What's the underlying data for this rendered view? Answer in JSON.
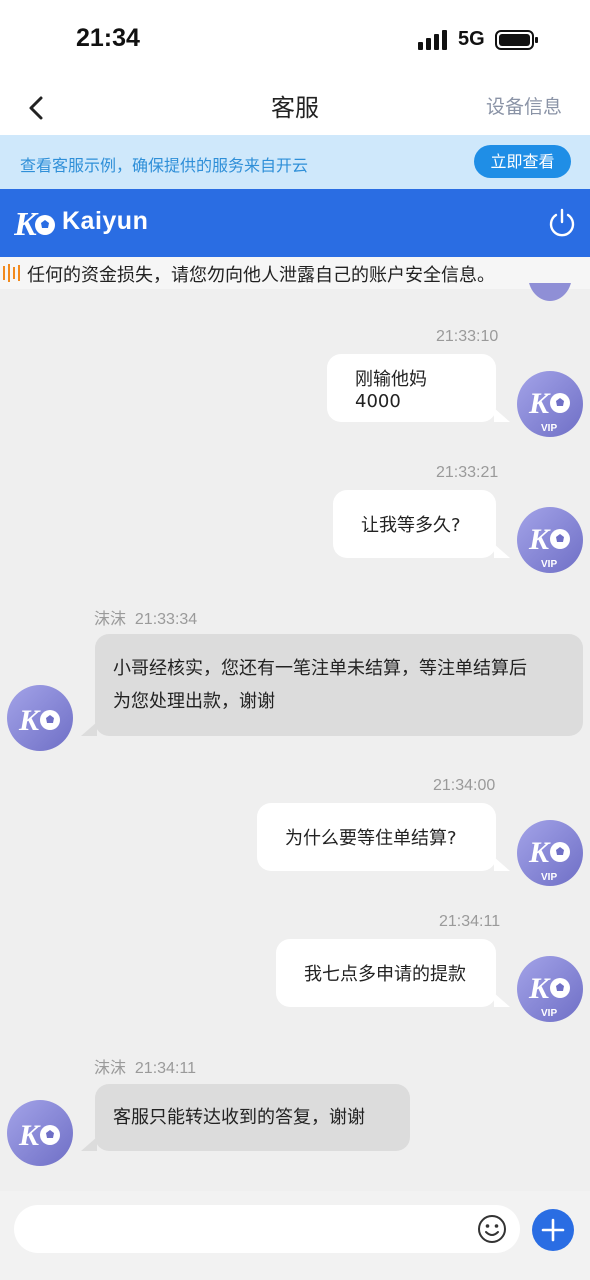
{
  "status_bar": {
    "time": "21:34",
    "network": "5G"
  },
  "nav": {
    "title": "客服",
    "device_info": "设备信息"
  },
  "banner": {
    "text": "查看客服示例，确保提供的服务来自开云",
    "button": "立即查看"
  },
  "brand": {
    "name": "Kaiyun"
  },
  "notice": {
    "text": "任何的资金损失，请您勿向他人泄露自己的账户安全信息。"
  },
  "avatar_vip_label": "VIP",
  "messages": [
    {
      "direction": "out",
      "time": "21:33:10",
      "text": "刚输他妈4000"
    },
    {
      "direction": "out",
      "time": "21:33:21",
      "text": "让我等多久?"
    },
    {
      "direction": "in",
      "sender": "沫沫",
      "time": "21:33:34",
      "line1": "小哥经核实，您还有一笔注单未结算，等注单结算后",
      "line2": "为您处理出款，谢谢"
    },
    {
      "direction": "out",
      "time": "21:34:00",
      "text": "为什么要等住单结算?"
    },
    {
      "direction": "out",
      "time": "21:34:11",
      "text": "我七点多申请的提款"
    },
    {
      "direction": "in",
      "sender": "沫沫",
      "time": "21:34:11",
      "text": "客服只能转达收到的答复，谢谢"
    }
  ],
  "colors": {
    "brand_blue": "#2a6de3",
    "banner_bg": "#cfe8fb",
    "banner_button": "#1f8ee6",
    "chat_bg": "#efefef",
    "incoming_bubble": "#dcdcdc",
    "outgoing_bubble": "#ffffff"
  },
  "icons": {
    "back": "chevron-left-icon",
    "power": "power-icon",
    "emoji": "smiley-icon",
    "plus": "plus-icon",
    "signal": "signal-icon",
    "battery": "battery-icon"
  }
}
